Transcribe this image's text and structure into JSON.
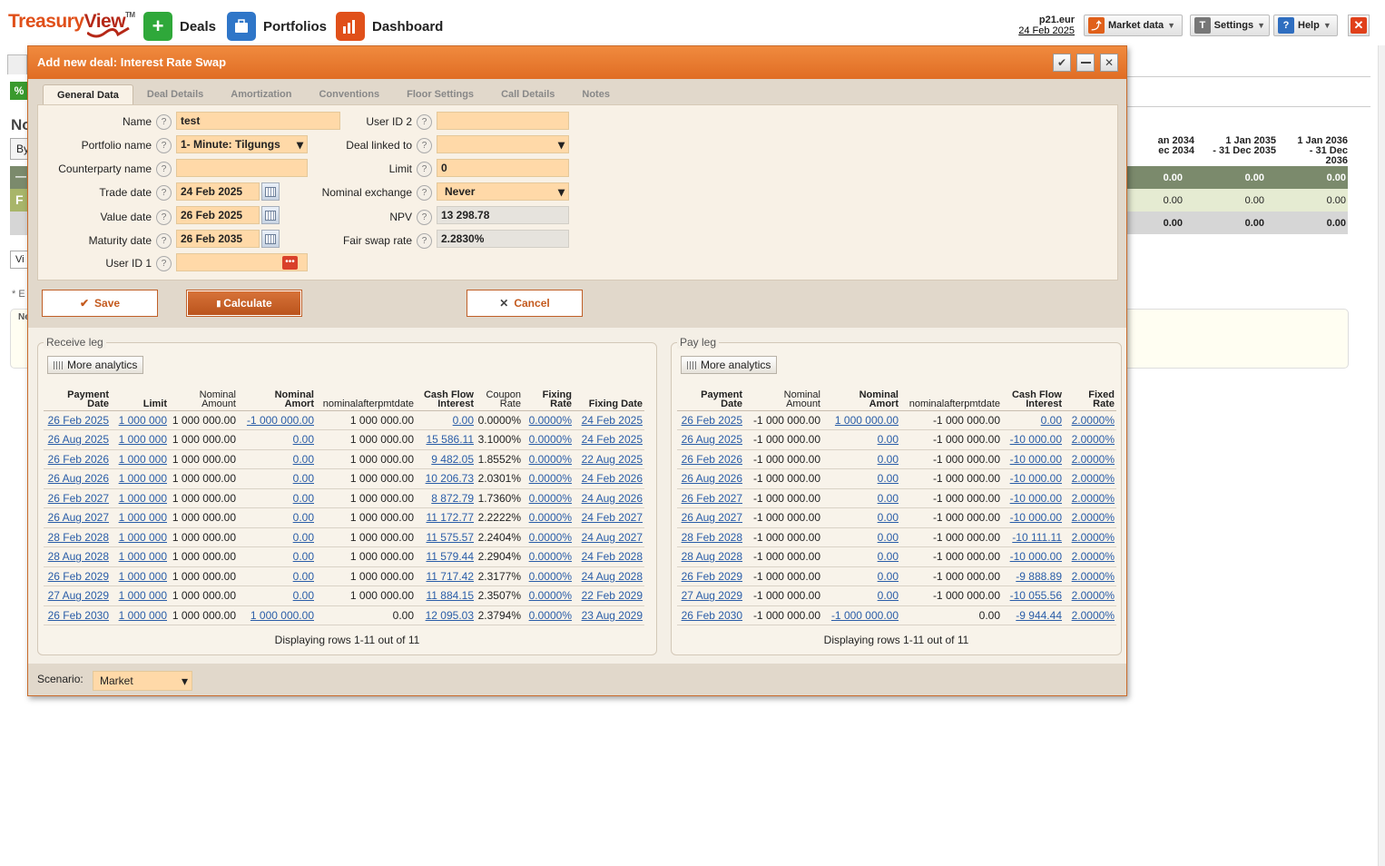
{
  "brand": {
    "name_a": "Treasury",
    "name_b": "View",
    "tm": "TM"
  },
  "nav": [
    {
      "label": "Deals",
      "icon": "plus-icon"
    },
    {
      "label": "Portfolios",
      "icon": "portfolio-icon"
    },
    {
      "label": "Dashboard",
      "icon": "dashboard-icon"
    }
  ],
  "user": {
    "name": "p21.eur",
    "date": "24 Feb 2025"
  },
  "toolbar": {
    "market": "Market data",
    "settings": "Settings",
    "help": "Help"
  },
  "background": {
    "letter_n": "No",
    "by": "By",
    "vi": "Vi",
    "star": "* E",
    "ne": "Ne",
    "cols": [
      {
        "l1": "an 2034",
        "l2": "ec 2034"
      },
      {
        "l1": "1 Jan 2035",
        "l2": "- 31 Dec 2035"
      },
      {
        "l1": "1 Jan 2036",
        "l2": "- 31 Dec 2036"
      }
    ],
    "row_values": [
      "0.00",
      "0.00",
      "0.00"
    ]
  },
  "dialog": {
    "title": "Add new deal: Interest Rate Swap",
    "tabs": [
      "General Data",
      "Deal Details",
      "Amortization",
      "Conventions",
      "Floor Settings",
      "Call Details",
      "Notes"
    ],
    "fields": {
      "name": {
        "label": "Name",
        "value": "test"
      },
      "portfolio": {
        "label": "Portfolio name",
        "value": "1- Minute: Tilgungs"
      },
      "counterparty": {
        "label": "Counterparty name",
        "value": ""
      },
      "trade_date": {
        "label": "Trade date",
        "value": "24 Feb 2025"
      },
      "value_date": {
        "label": "Value date",
        "value": "26 Feb 2025"
      },
      "maturity_date": {
        "label": "Maturity date",
        "value": "26 Feb 2035"
      },
      "user_id1": {
        "label": "User ID 1",
        "value": ""
      },
      "user_id2": {
        "label": "User ID 2",
        "value": ""
      },
      "deal_linked": {
        "label": "Deal linked to",
        "value": ""
      },
      "limit": {
        "label": "Limit",
        "value": "0"
      },
      "nominal_exchange": {
        "label": "Nominal exchange",
        "value": "Never"
      },
      "npv": {
        "label": "NPV",
        "value": "13 298.78"
      },
      "fair_rate": {
        "label": "Fair swap rate",
        "value": "2.2830%"
      }
    },
    "help_glyph": "?",
    "buttons": {
      "save": "Save",
      "calculate": "Calculate",
      "cancel": "Cancel"
    },
    "scenario": {
      "label": "Scenario:",
      "value": "Market"
    }
  },
  "receive_leg": {
    "title": "Receive leg",
    "more": "More analytics",
    "headers": [
      {
        "l1": "Payment",
        "l2": "Date",
        "bold": true
      },
      {
        "l1": "",
        "l2": "Limit",
        "bold": true
      },
      {
        "l1": "Nominal",
        "l2": "Amount",
        "bold": false
      },
      {
        "l1": "Nominal",
        "l2": "Amort",
        "bold": true
      },
      {
        "l1": "",
        "l2": "nominalafterpmtdate",
        "bold": false
      },
      {
        "l1": "Cash Flow",
        "l2": "Interest",
        "bold": true
      },
      {
        "l1": "Coupon",
        "l2": "Rate",
        "bold": false
      },
      {
        "l1": "Fixing",
        "l2": "Rate",
        "bold": true
      },
      {
        "l1": "",
        "l2": "Fixing Date",
        "bold": true
      }
    ],
    "rows": [
      [
        "26 Feb 2025",
        "1 000 000",
        "1 000 000.00",
        "-1 000 000.00",
        "1 000 000.00",
        "0.00",
        "0.0000%",
        "0.0000%",
        "24 Feb 2025"
      ],
      [
        "26 Aug 2025",
        "1 000 000",
        "1 000 000.00",
        "0.00",
        "1 000 000.00",
        "15 586.11",
        "3.1000%",
        "0.0000%",
        "24 Feb 2025"
      ],
      [
        "26 Feb 2026",
        "1 000 000",
        "1 000 000.00",
        "0.00",
        "1 000 000.00",
        "9 482.05",
        "1.8552%",
        "0.0000%",
        "22 Aug 2025"
      ],
      [
        "26 Aug 2026",
        "1 000 000",
        "1 000 000.00",
        "0.00",
        "1 000 000.00",
        "10 206.73",
        "2.0301%",
        "0.0000%",
        "24 Feb 2026"
      ],
      [
        "26 Feb 2027",
        "1 000 000",
        "1 000 000.00",
        "0.00",
        "1 000 000.00",
        "8 872.79",
        "1.7360%",
        "0.0000%",
        "24 Aug 2026"
      ],
      [
        "26 Aug 2027",
        "1 000 000",
        "1 000 000.00",
        "0.00",
        "1 000 000.00",
        "11 172.77",
        "2.2222%",
        "0.0000%",
        "24 Feb 2027"
      ],
      [
        "28 Feb 2028",
        "1 000 000",
        "1 000 000.00",
        "0.00",
        "1 000 000.00",
        "11 575.57",
        "2.2404%",
        "0.0000%",
        "24 Aug 2027"
      ],
      [
        "28 Aug 2028",
        "1 000 000",
        "1 000 000.00",
        "0.00",
        "1 000 000.00",
        "11 579.44",
        "2.2904%",
        "0.0000%",
        "24 Feb 2028"
      ],
      [
        "26 Feb 2029",
        "1 000 000",
        "1 000 000.00",
        "0.00",
        "1 000 000.00",
        "11 717.42",
        "2.3177%",
        "0.0000%",
        "24 Aug 2028"
      ],
      [
        "27 Aug 2029",
        "1 000 000",
        "1 000 000.00",
        "0.00",
        "1 000 000.00",
        "11 884.15",
        "2.3507%",
        "0.0000%",
        "22 Feb 2029"
      ],
      [
        "26 Feb 2030",
        "1 000 000",
        "1 000 000.00",
        "1 000 000.00",
        "0.00",
        "12 095.03",
        "2.3794%",
        "0.0000%",
        "23 Aug 2029"
      ]
    ],
    "link_cols": [
      0,
      1,
      3,
      5,
      7,
      8
    ],
    "display": "Displaying rows 1-11 out of 11"
  },
  "pay_leg": {
    "title": "Pay leg",
    "more": "More analytics",
    "headers": [
      {
        "l1": "Payment",
        "l2": "Date",
        "bold": true
      },
      {
        "l1": "Nominal",
        "l2": "Amount",
        "bold": false
      },
      {
        "l1": "Nominal",
        "l2": "Amort",
        "bold": true
      },
      {
        "l1": "",
        "l2": "nominalafterpmtdate",
        "bold": false
      },
      {
        "l1": "Cash Flow",
        "l2": "Interest",
        "bold": true
      },
      {
        "l1": "Fixed",
        "l2": "Rate",
        "bold": true
      }
    ],
    "rows": [
      [
        "26 Feb 2025",
        "-1 000 000.00",
        "1 000 000.00",
        "-1 000 000.00",
        "0.00",
        "2.0000%"
      ],
      [
        "26 Aug 2025",
        "-1 000 000.00",
        "0.00",
        "-1 000 000.00",
        "-10 000.00",
        "2.0000%"
      ],
      [
        "26 Feb 2026",
        "-1 000 000.00",
        "0.00",
        "-1 000 000.00",
        "-10 000.00",
        "2.0000%"
      ],
      [
        "26 Aug 2026",
        "-1 000 000.00",
        "0.00",
        "-1 000 000.00",
        "-10 000.00",
        "2.0000%"
      ],
      [
        "26 Feb 2027",
        "-1 000 000.00",
        "0.00",
        "-1 000 000.00",
        "-10 000.00",
        "2.0000%"
      ],
      [
        "26 Aug 2027",
        "-1 000 000.00",
        "0.00",
        "-1 000 000.00",
        "-10 000.00",
        "2.0000%"
      ],
      [
        "28 Feb 2028",
        "-1 000 000.00",
        "0.00",
        "-1 000 000.00",
        "-10 111.11",
        "2.0000%"
      ],
      [
        "28 Aug 2028",
        "-1 000 000.00",
        "0.00",
        "-1 000 000.00",
        "-10 000.00",
        "2.0000%"
      ],
      [
        "26 Feb 2029",
        "-1 000 000.00",
        "0.00",
        "-1 000 000.00",
        "-9 888.89",
        "2.0000%"
      ],
      [
        "27 Aug 2029",
        "-1 000 000.00",
        "0.00",
        "-1 000 000.00",
        "-10 055.56",
        "2.0000%"
      ],
      [
        "26 Feb 2030",
        "-1 000 000.00",
        "-1 000 000.00",
        "0.00",
        "-9 944.44",
        "2.0000%"
      ]
    ],
    "link_cols": [
      0,
      2,
      4,
      5
    ],
    "display": "Displaying rows 1-11 out of 11"
  }
}
